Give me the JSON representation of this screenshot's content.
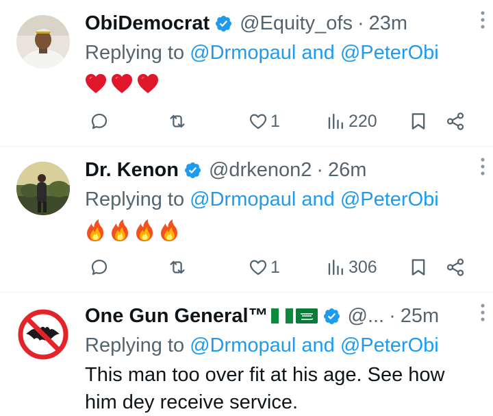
{
  "tweets": [
    {
      "name": "ObiDemocrat",
      "handle": "@Equity_ofs",
      "dot": "·",
      "time": "23m",
      "replying_prefix": "Replying to ",
      "mention1": "@Drmopaul",
      "and_word": " and ",
      "mention2": "@PeterObi",
      "emoji": [
        "red-heart",
        "red-heart",
        "red-heart"
      ],
      "likes": "1",
      "views": "220"
    },
    {
      "name": "Dr. Kenon",
      "handle": "@drkenon2",
      "dot": "·",
      "time": "26m",
      "replying_prefix": "Replying to ",
      "mention1": "@Drmopaul",
      "and_word": " and ",
      "mention2": "@PeterObi",
      "emoji": [
        "fire",
        "fire",
        "fire",
        "fire"
      ],
      "likes": "1",
      "views": "306"
    },
    {
      "name": "One Gun General™",
      "name_flags": [
        "nigeria-flag",
        "saudi-arabia-flag"
      ],
      "handle": "@...",
      "dot": "·",
      "time": "25m",
      "replying_prefix": "Replying to ",
      "mention1": "@Drmopaul",
      "and_word": " and ",
      "mention2": "@PeterObi",
      "text_line1": "This man too over fit at his age. See how",
      "text_line2": "him dey receive service."
    }
  ],
  "colors": {
    "accent": "#1d9bf0",
    "secondary_text": "#536471",
    "primary_text": "#0f1419",
    "divider": "#eff3f4"
  },
  "icons": [
    "verified-badge-icon",
    "more-icon",
    "reply-icon",
    "retweet-icon",
    "like-icon",
    "views-icon",
    "bookmark-icon",
    "share-icon"
  ]
}
